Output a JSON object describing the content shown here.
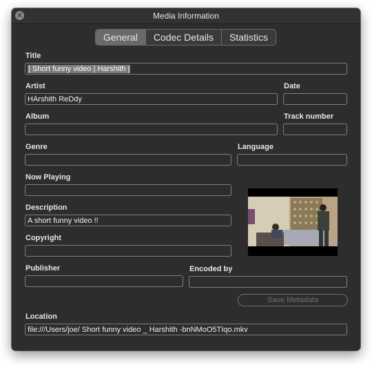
{
  "window": {
    "title": "Media Information",
    "close_glyph": "✕"
  },
  "tabs": [
    {
      "label": "General",
      "active": true
    },
    {
      "label": "Codec Details",
      "active": false
    },
    {
      "label": "Statistics",
      "active": false
    }
  ],
  "fields": {
    "title": {
      "label": "Title",
      "value": "| Short funny video | Harshith |"
    },
    "artist": {
      "label": "Artist",
      "value": "HArshith ReDdy"
    },
    "date": {
      "label": "Date",
      "value": ""
    },
    "album": {
      "label": "Album",
      "value": ""
    },
    "track_number": {
      "label": "Track number",
      "value": ""
    },
    "genre": {
      "label": "Genre",
      "value": ""
    },
    "language": {
      "label": "Language",
      "value": ""
    },
    "now_playing": {
      "label": "Now Playing",
      "value": ""
    },
    "description": {
      "label": "Description",
      "value": "A short funny video !!"
    },
    "copyright": {
      "label": "Copyright",
      "value": ""
    },
    "publisher": {
      "label": "Publisher",
      "value": ""
    },
    "encoded_by": {
      "label": "Encoded by",
      "value": ""
    },
    "location": {
      "label": "Location",
      "value": "file:///Users/joe/ Short funny video _ Harshith -bnNMoO5TIqo.mkv"
    }
  },
  "save_button": {
    "label": "Save Metadata",
    "enabled": false
  },
  "artwork": {
    "icon": "video-thumbnail"
  },
  "colors": {
    "window_bg": "#2d2d2d",
    "field_border": "#808080",
    "selection": "#7a7a7a"
  }
}
